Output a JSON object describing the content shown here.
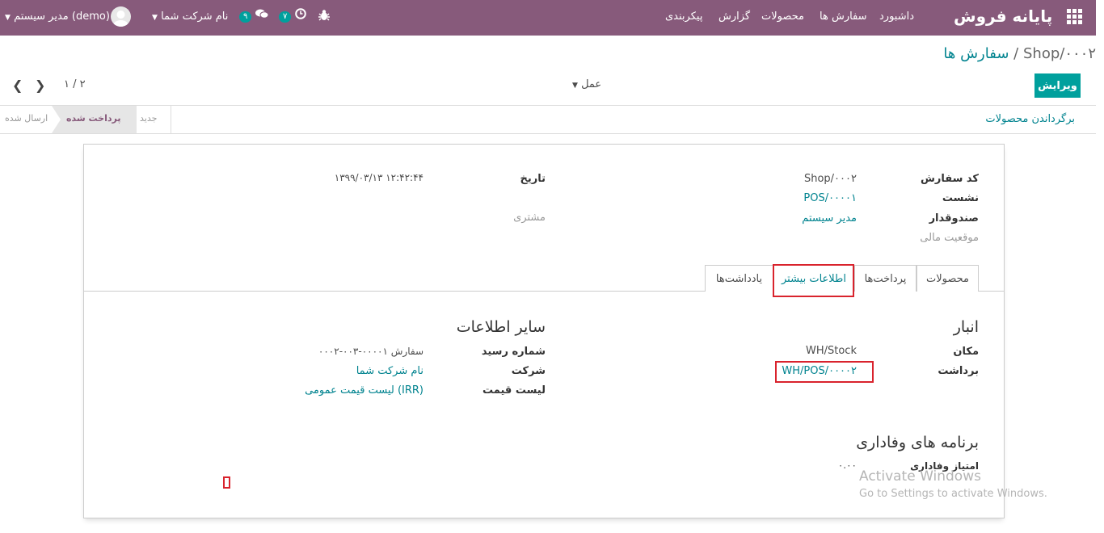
{
  "navbar": {
    "brand": "پایانه فروش",
    "menu": [
      "داشبورد",
      "سفارش ها",
      "محصولات",
      "گزارش",
      "پیکربندی"
    ],
    "messages_count": "۹",
    "activities_count": "۷",
    "company": "نام شرکت شما",
    "user": "مدیر سیستم (demo)",
    "color": "#875a7b"
  },
  "control": {
    "breadcrumb_parent": "سفارش ها",
    "breadcrumb_sep": "/",
    "breadcrumb_current": "Shop/۰۰۰۲",
    "edit_label": "ویرایش",
    "action_label": "عمل",
    "pager": "۱ / ۲"
  },
  "statusbar": {
    "return_label": "برگرداندن محصولات",
    "stages": [
      "جدید",
      "پرداخت شده",
      "ارسال شده"
    ],
    "active_stage": "پرداخت شده"
  },
  "form": {
    "order_ref_label": "کد سفارش",
    "order_ref": "Shop/۰۰۰۲",
    "session_label": "نشست",
    "session": "POS/۰۰۰۰۱",
    "cashier_label": "صندوقدار",
    "cashier": "مدیر سیستم",
    "fiscal_label": "موقعیت مالی",
    "date_label": "تاریخ",
    "date": "۱۳۹۹/۰۳/۱۳ ۱۲:۴۲:۴۴",
    "customer_label": "مشتری"
  },
  "tabs": [
    "محصولات",
    "پرداخت‌ها",
    "اطلاعات بیشتر",
    "یادداشت‌ها"
  ],
  "extra": {
    "warehouse_title": "انبار",
    "location_label": "مکان",
    "location": "WH/Stock",
    "picking_label": "برداشت",
    "picking": "WH/POS/۰۰۰۰۲",
    "other_title": "سایر اطلاعات",
    "receipt_label": "شماره رسید",
    "receipt": "سفارش ۰۰۰۰۱-۰۰۳-۰۰۰۲",
    "company_label": "شرکت",
    "company": "نام شرکت شما",
    "pricelist_label": "لیست قیمت",
    "pricelist": "لیست قیمت عمومی (IRR)",
    "loyalty_title": "برنامه های وفاداری",
    "loyalty_label": "امتیاز وفاداری",
    "loyalty_points": "۰.۰۰"
  },
  "watermark": {
    "line1": "Activate Windows",
    "line2": "Go to Settings to activate Windows."
  }
}
